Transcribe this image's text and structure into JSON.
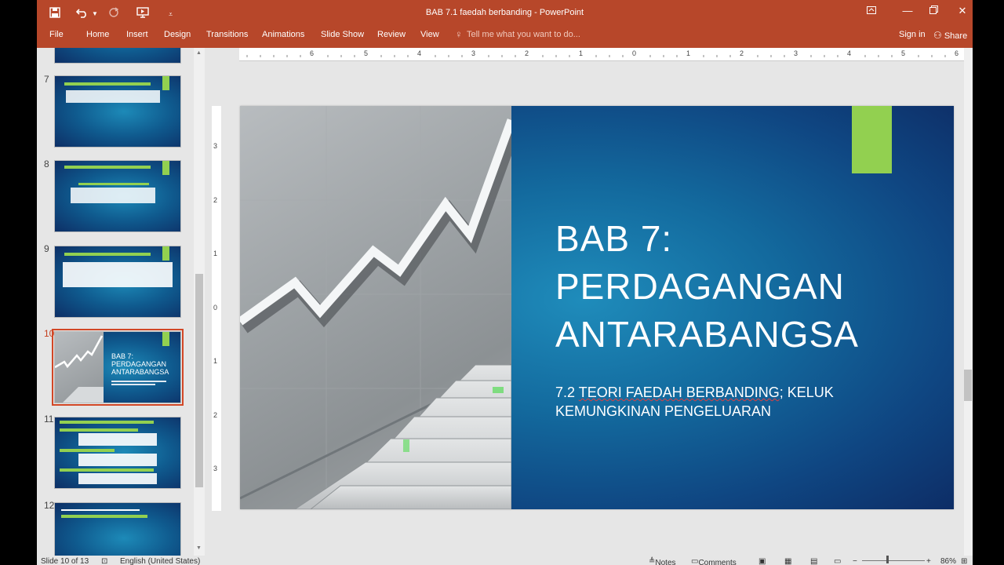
{
  "window": {
    "title": "BAB 7.1 faedah berbanding - PowerPoint"
  },
  "quick_access": {
    "save_icon": "save-icon",
    "undo_icon": "undo-icon",
    "redo_icon": "redo-icon",
    "present_icon": "present-from-start-icon",
    "customize_icon": "customize-qat-icon"
  },
  "ribbon": {
    "tabs": [
      "File",
      "Home",
      "Insert",
      "Design",
      "Transitions",
      "Animations",
      "Slide Show",
      "Review",
      "View"
    ],
    "tell_me": "Tell me what you want to do...",
    "sign_in": "Sign in",
    "share": "Share"
  },
  "thumbnails": [
    {
      "number": "7"
    },
    {
      "number": "8"
    },
    {
      "number": "9"
    },
    {
      "number": "10",
      "title": "BAB 7:",
      "title2": "PERDAGANGAN",
      "title3": "ANTARABANGSA",
      "active": true
    },
    {
      "number": "11"
    },
    {
      "number": "12"
    }
  ],
  "rulers": {
    "h_ticks": [
      "6",
      "5",
      "4",
      "3",
      "2",
      "1",
      "0",
      "1",
      "2",
      "3",
      "4",
      "5",
      "6"
    ],
    "v_ticks": [
      "3",
      "2",
      "1",
      "0",
      "1",
      "2",
      "3"
    ]
  },
  "slide": {
    "title_line1": "BAB 7:",
    "title_line2": "PERDAGANGAN",
    "title_line3": "ANTARABANGSA",
    "subtitle_a": "7.2 ",
    "subtitle_b": "TEORI FAEDAH BERBANDING",
    "subtitle_c": "; KELUK",
    "subtitle_line2": "KEMUNGKINAN PENGELUARAN",
    "accent": "#92d050"
  },
  "status_bar": {
    "slide_info": "Slide 10 of 13",
    "language": "English (United States)",
    "notes": "Notes",
    "comments": "Comments",
    "zoom": "86%"
  },
  "colors": {
    "ribbon": "#b7472a",
    "accent_green": "#92d050",
    "selection": "#d24726"
  }
}
